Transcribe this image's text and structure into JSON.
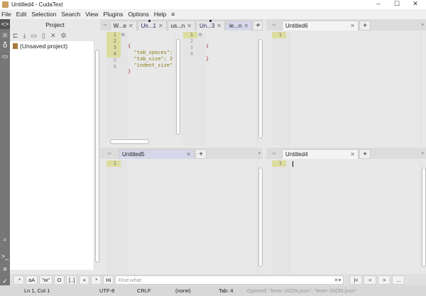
{
  "window": {
    "title": "Untitled4 - CudaText",
    "controls": [
      "–",
      "☐",
      "✕"
    ]
  },
  "menu": [
    "File",
    "Edit",
    "Selection",
    "Search",
    "View",
    "Plugins",
    "Options",
    "Help",
    "≡"
  ],
  "project": {
    "header": "Project",
    "tree": [
      "(Unsaved project)"
    ]
  },
  "groups": {
    "top_left": {
      "tabs": [
        {
          "label": "W...e"
        },
        {
          "label": "Un...1",
          "modified": true
        },
        {
          "label": "us...n"
        },
        {
          "label": "Un...3",
          "modified": true
        },
        {
          "label": "le...n"
        }
      ],
      "editor1": {
        "line_numbers": [
          "1",
          "2",
          "3",
          "4",
          "5",
          "6"
        ],
        "lines": [
          "{",
          "  \"tab_spaces\":",
          "  \"tab_size\": 2",
          "  \"indent_size\"",
          "}",
          ""
        ]
      },
      "editor2": {
        "line_numbers": [
          "1",
          "2",
          "3",
          "4"
        ],
        "lines": [
          "{",
          "",
          "}",
          ""
        ]
      }
    },
    "top_right": {
      "tabs": [
        {
          "label": "Untitled6"
        }
      ],
      "line_numbers": [
        "1"
      ]
    },
    "bottom_left": {
      "tabs": [
        {
          "label": "Untitled5"
        }
      ],
      "line_numbers": [
        "1"
      ]
    },
    "bottom_right": {
      "tabs": [
        {
          "label": "Untitled4"
        }
      ],
      "line_numbers": [
        "1"
      ]
    }
  },
  "findbar": {
    "buttons": [
      ".*",
      "aA",
      "\"w\"",
      "O",
      "[..]",
      "+",
      "*",
      "Hi"
    ],
    "placeholder": "Find what",
    "nav": [
      "|<",
      "<",
      ">",
      "..."
    ]
  },
  "status": {
    "position": "Ln 1, Col 1",
    "encoding": "UTF-8",
    "line_ending": "CRLF",
    "lexer": "(none)",
    "tab": "Tab: 4",
    "message": "Opened: \"lexer JSON.json\", \"lexer JSON.json\""
  }
}
